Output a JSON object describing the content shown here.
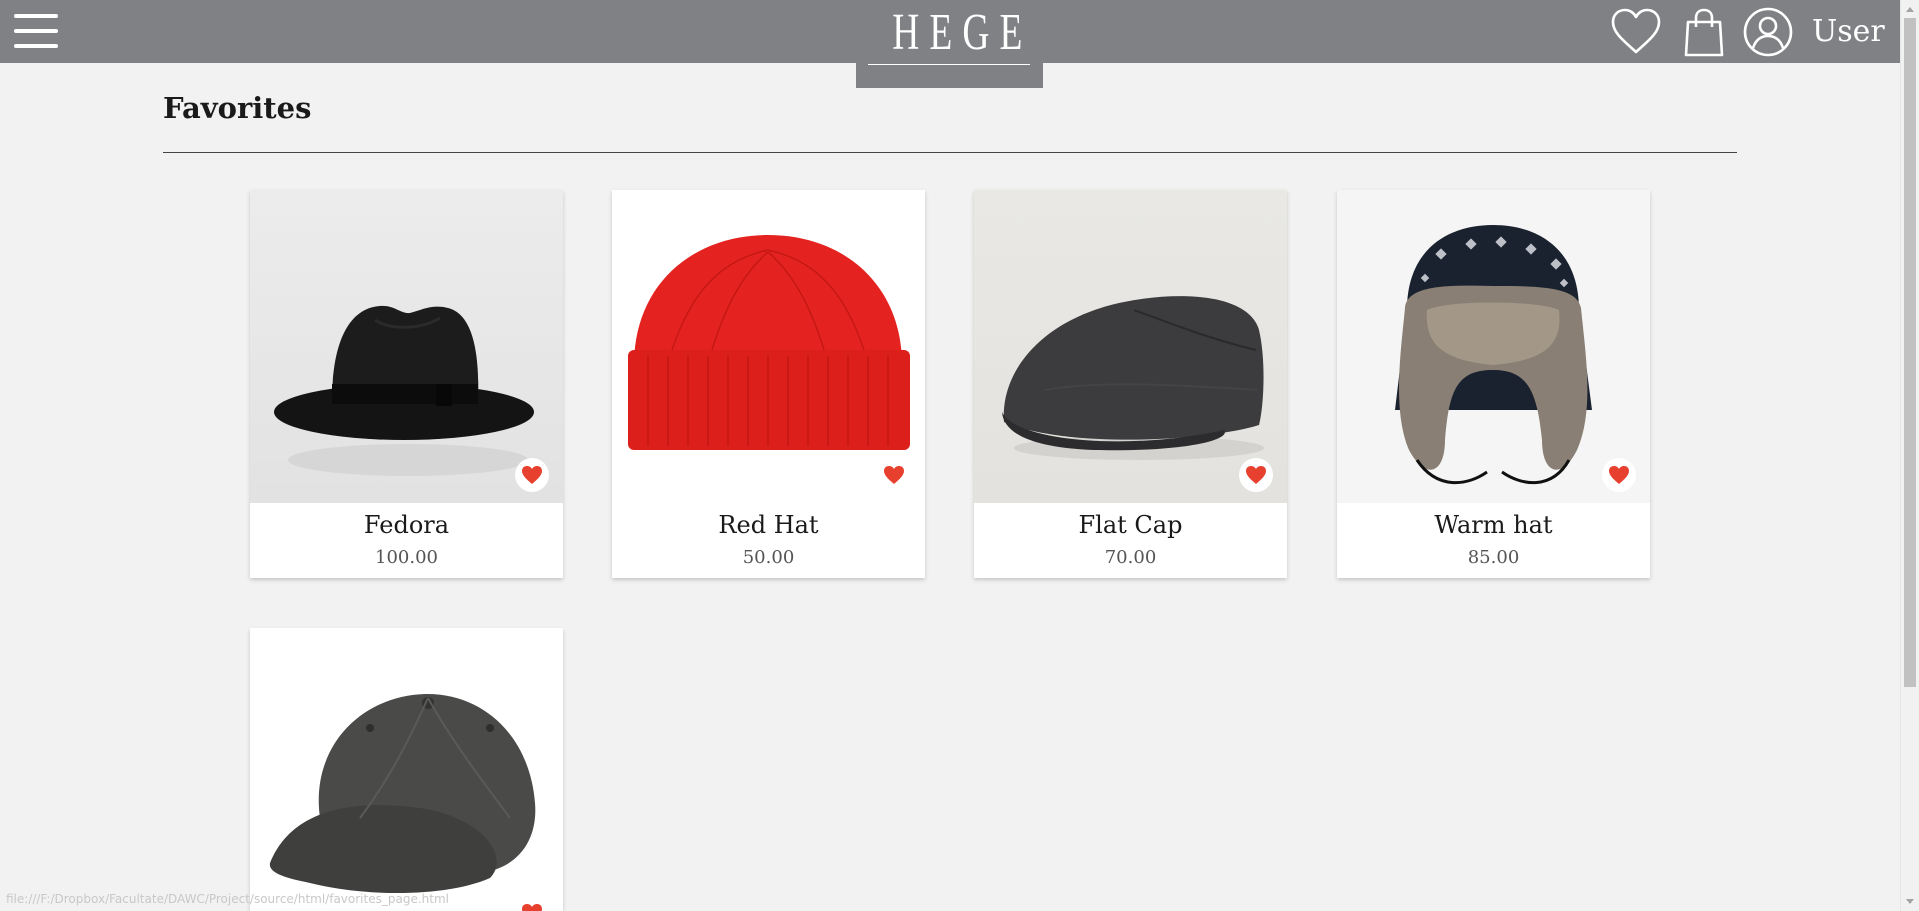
{
  "header": {
    "brand": "HEGE",
    "user_label": "User",
    "icons": [
      "menu-icon",
      "heart-icon",
      "shopping-bag-icon",
      "user-icon"
    ]
  },
  "page": {
    "title": "Favorites"
  },
  "products": [
    {
      "name": "Fedora",
      "price": "100.00",
      "favorite": true
    },
    {
      "name": "Red Hat",
      "price": "50.00",
      "favorite": true
    },
    {
      "name": "Flat Cap",
      "price": "70.00",
      "favorite": true
    },
    {
      "name": "Warm hat",
      "price": "85.00",
      "favorite": true
    },
    {
      "name": "",
      "price": "",
      "favorite": true
    }
  ],
  "status_bar": {
    "url": "file:///F:/Dropbox/Facultate/DAWC/Project/source/html/favorites_page.html"
  },
  "colors": {
    "header_bg": "#808185",
    "page_bg": "#f2f2f2",
    "favorite_heart": "#e8402e"
  }
}
